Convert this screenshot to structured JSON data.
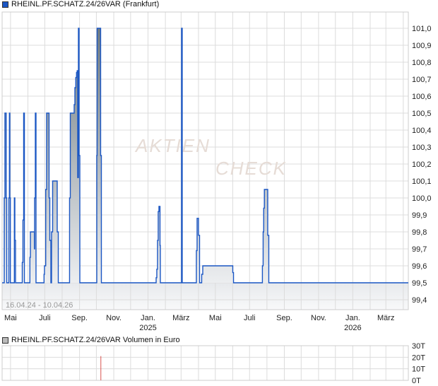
{
  "legend_price": "RHEINL.PF.SCHATZ.24/26VAR (Frankfurt)",
  "legend_volume": "RHEINL.PF.SCHATZ.24/26VAR Volumen in Euro",
  "date_range": "16.04.24 - 10.04.26",
  "watermark": [
    "AKTIEN",
    "CHECK"
  ],
  "colors": {
    "line": "#1a56c4",
    "grid": "#dcdcdc",
    "volume_bar": "#d9534f",
    "fill_top": "#7e8a91",
    "fill_bottom": "#eceef0"
  },
  "chart_data": [
    {
      "type": "line",
      "title": "RHEINL.PF.SCHATZ.24/26VAR (Frankfurt)",
      "x_start_date": "2024-04-16",
      "x_end_date": "2026-04-10",
      "x_unit": "days since 2024-04-16",
      "ylim": [
        99.36,
        101.1
      ],
      "yticks": [
        99.4,
        99.5,
        99.6,
        99.7,
        99.8,
        99.9,
        100.0,
        100.1,
        100.2,
        100.3,
        100.4,
        100.5,
        100.6,
        100.7,
        100.8,
        100.9,
        101.0
      ],
      "ytick_labels": [
        "99,4",
        "99,5",
        "99,6",
        "99,7",
        "99,8",
        "99,9",
        "100,0",
        "100,1",
        "100,2",
        "100,3",
        "100,4",
        "100,5",
        "100,6",
        "100,7",
        "100,8",
        "100,9",
        "101,0"
      ],
      "xticks": [
        {
          "date": "2024-05-01",
          "label": "Mai",
          "year": ""
        },
        {
          "date": "2024-07-01",
          "label": "Juli",
          "year": ""
        },
        {
          "date": "2024-09-01",
          "label": "Sep.",
          "year": ""
        },
        {
          "date": "2024-11-01",
          "label": "Nov.",
          "year": ""
        },
        {
          "date": "2025-01-01",
          "label": "Jan.",
          "year": "2025"
        },
        {
          "date": "2025-03-01",
          "label": "März",
          "year": ""
        },
        {
          "date": "2025-05-01",
          "label": "Mai",
          "year": ""
        },
        {
          "date": "2025-07-01",
          "label": "Juli",
          "year": ""
        },
        {
          "date": "2025-09-01",
          "label": "Sep.",
          "year": ""
        },
        {
          "date": "2025-11-01",
          "label": "Nov.",
          "year": ""
        },
        {
          "date": "2026-01-01",
          "label": "Jan.",
          "year": "2026"
        },
        {
          "date": "2026-03-01",
          "label": "März",
          "year": ""
        }
      ],
      "grid": true,
      "steps": [
        [
          0,
          99.5
        ],
        [
          3.8,
          100.0
        ],
        [
          5.0,
          100.5
        ],
        [
          7.2,
          100.0
        ],
        [
          8.2,
          99.5
        ],
        [
          12.0,
          100.0
        ],
        [
          13.0,
          100.5
        ],
        [
          13.8,
          100.0
        ],
        [
          14.7,
          99.5
        ],
        [
          21.8,
          100.0
        ],
        [
          22.7,
          99.75
        ],
        [
          23.9,
          99.5
        ],
        [
          35.9,
          99.62
        ],
        [
          37.1,
          99.87
        ],
        [
          38.4,
          100.5
        ],
        [
          39.7,
          99.5
        ],
        [
          49.5,
          99.65
        ],
        [
          50.4,
          99.8
        ],
        [
          57.5,
          99.7
        ],
        [
          57.9,
          100.0
        ],
        [
          59.2,
          100.5
        ],
        [
          60.4,
          99.5
        ],
        [
          74.7,
          99.55
        ],
        [
          75.5,
          99.6
        ],
        [
          77.7,
          100.05
        ],
        [
          79.3,
          100.5
        ],
        [
          83.7,
          100.0
        ],
        [
          85.0,
          99.75
        ],
        [
          86.9,
          99.5
        ],
        [
          88.1,
          99.8
        ],
        [
          90.0,
          100.1
        ],
        [
          98.2,
          99.8
        ],
        [
          100.1,
          99.5
        ],
        [
          120.2,
          100.0
        ],
        [
          121.5,
          100.5
        ],
        [
          128.4,
          100.55
        ],
        [
          129.7,
          100.65
        ],
        [
          131.3,
          100.71
        ],
        [
          132.6,
          100.74
        ],
        [
          133.8,
          100.75
        ],
        [
          134.7,
          100.12
        ],
        [
          136.0,
          101.0
        ],
        [
          137.2,
          100.25
        ],
        [
          138.5,
          99.5
        ],
        [
          168.7,
          100.25
        ],
        [
          169.3,
          101.0
        ],
        [
          175.6,
          100.25
        ],
        [
          176.9,
          99.5
        ],
        [
          274.5,
          99.53
        ],
        [
          275.7,
          99.58
        ],
        [
          277.0,
          99.75
        ],
        [
          278.2,
          99.92
        ],
        [
          279.5,
          99.95
        ],
        [
          281.4,
          99.72
        ],
        [
          282.0,
          99.5
        ],
        [
          319.8,
          101.0
        ],
        [
          321.0,
          99.5
        ],
        [
          346.2,
          99.69
        ],
        [
          347.5,
          99.88
        ],
        [
          350.0,
          99.78
        ],
        [
          351.9,
          99.5
        ],
        [
          355.7,
          99.55
        ],
        [
          357.6,
          99.6
        ],
        [
          411.1,
          99.56
        ],
        [
          412.4,
          99.5
        ],
        [
          463.9,
          99.6
        ],
        [
          465.2,
          99.8
        ],
        [
          466.2,
          99.94
        ],
        [
          467.4,
          100.05
        ],
        [
          473.4,
          99.78
        ],
        [
          475.3,
          99.5
        ],
        [
          724,
          99.5
        ]
      ]
    },
    {
      "type": "bar",
      "title": "RHEINL.PF.SCHATZ.24/26VAR Volumen in Euro",
      "ylim": [
        0,
        30
      ],
      "yticks": [
        0,
        10,
        20,
        30
      ],
      "ytick_labels": [
        "0T",
        "10T",
        "20T",
        "30T"
      ],
      "bars": [
        {
          "day": 176,
          "value": 21
        }
      ]
    }
  ]
}
